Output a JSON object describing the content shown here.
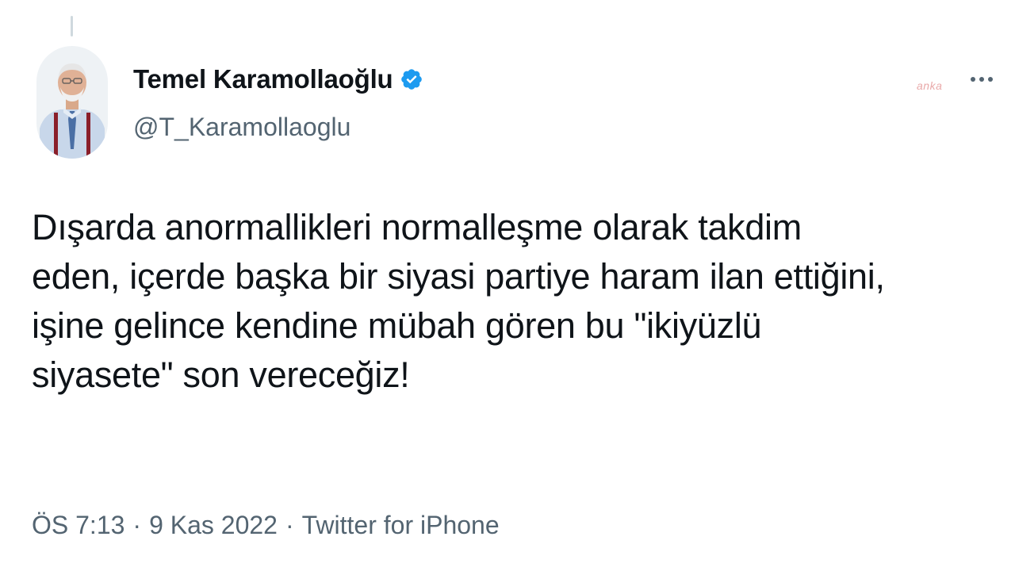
{
  "author": {
    "display_name": "Temel Karamollaoğlu",
    "handle": "@T_Karamollaoglu",
    "verified": true,
    "avatar_icon": "profile-photo"
  },
  "watermark": "anka",
  "more_icon": "more-dots-icon",
  "tweet": {
    "text": "Dışarda anormallikleri normalleşme olarak takdim\neden, içerde başka bir siyasi partiye haram ilan ettiğini,\nişine gelince kendine mübah gören bu \"ikiyüzlü\nsiyasete\" son vereceğiz!"
  },
  "meta": {
    "time": "ÖS 7:13",
    "date": "9 Kas 2022",
    "source": "Twitter for iPhone",
    "separator": "·"
  },
  "colors": {
    "text": "#0f1419",
    "secondary": "#536471",
    "verified": "#1d9bf0"
  }
}
